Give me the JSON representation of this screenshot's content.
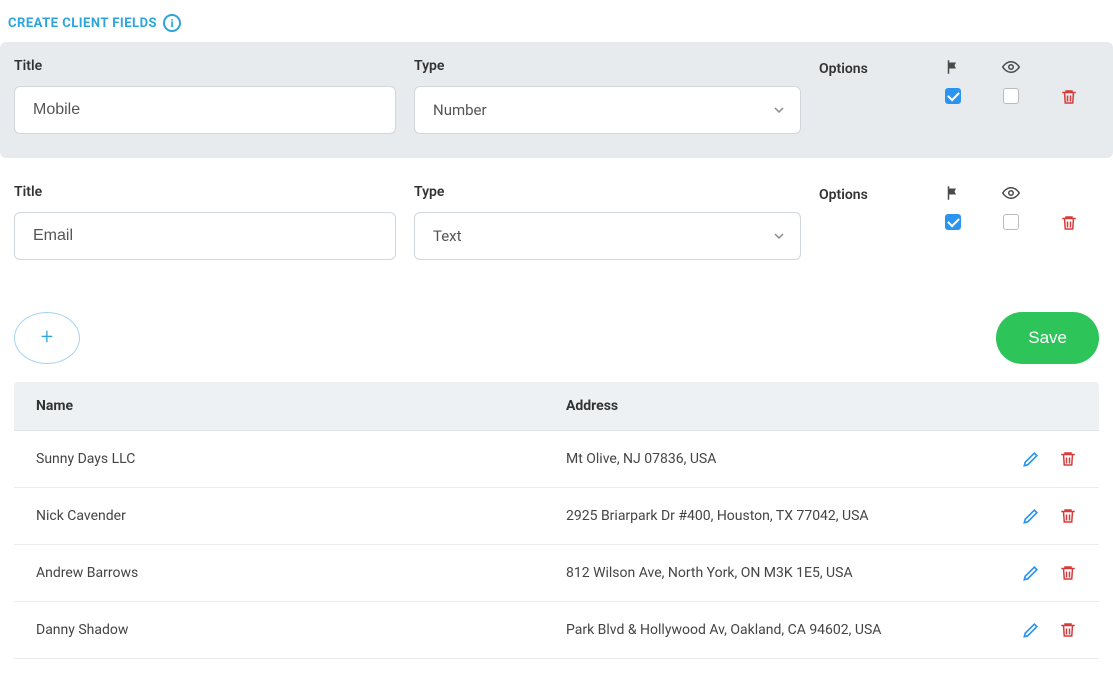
{
  "header": {
    "title": "CREATE CLIENT FIELDS"
  },
  "labels": {
    "title": "Title",
    "type": "Type",
    "options": "Options"
  },
  "fields": [
    {
      "title_value": "Mobile",
      "type_value": "Number",
      "flag_checked": true,
      "eye_checked": false
    },
    {
      "title_value": "Email",
      "type_value": "Text",
      "flag_checked": true,
      "eye_checked": false
    }
  ],
  "actions": {
    "save_label": "Save"
  },
  "table": {
    "headers": {
      "name": "Name",
      "address": "Address"
    },
    "rows": [
      {
        "name": "Sunny Days LLC",
        "address": "Mt Olive, NJ 07836, USA"
      },
      {
        "name": "Nick Cavender",
        "address": "2925 Briarpark Dr #400, Houston, TX 77042, USA"
      },
      {
        "name": "Andrew Barrows",
        "address": "812 Wilson Ave, North York, ON M3K 1E5, USA"
      },
      {
        "name": "Danny Shadow",
        "address": "Park Blvd & Hollywood Av, Oakland, CA 94602, USA"
      }
    ]
  }
}
